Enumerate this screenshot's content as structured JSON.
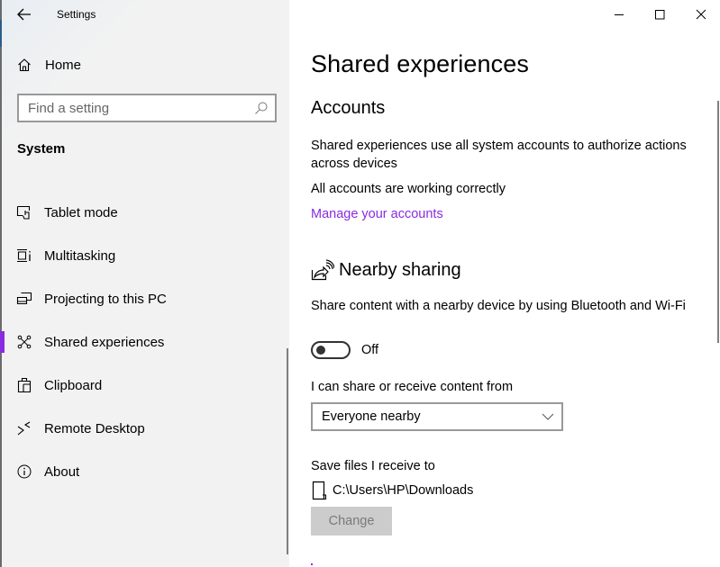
{
  "window": {
    "app_title": "Settings",
    "controls": {
      "minimize": "minimize-icon",
      "maximize": "maximize-icon",
      "close": "close-icon"
    }
  },
  "sidebar": {
    "home_label": "Home",
    "search": {
      "placeholder": "Find a setting",
      "value": ""
    },
    "section_label": "System",
    "items": [
      {
        "label": "Tablet mode",
        "icon": "tablet-mode-icon",
        "active": false
      },
      {
        "label": "Multitasking",
        "icon": "multitasking-icon",
        "active": false
      },
      {
        "label": "Projecting to this PC",
        "icon": "projecting-icon",
        "active": false
      },
      {
        "label": "Shared experiences",
        "icon": "shared-experiences-icon",
        "active": true
      },
      {
        "label": "Clipboard",
        "icon": "clipboard-icon",
        "active": false
      },
      {
        "label": "Remote Desktop",
        "icon": "remote-desktop-icon",
        "active": false
      },
      {
        "label": "About",
        "icon": "info-icon",
        "active": false
      }
    ]
  },
  "main": {
    "page_title": "Shared experiences",
    "accounts": {
      "heading": "Accounts",
      "description": "Shared experiences use all system accounts to authorize actions across devices",
      "status": "All accounts are working correctly",
      "link": "Manage your accounts"
    },
    "nearby_sharing": {
      "heading": "Nearby sharing",
      "description": "Share content with a nearby device by using Bluetooth and Wi-Fi",
      "toggle_state": "Off",
      "share_from_label": "I can share or receive content from",
      "share_from_value": "Everyone nearby",
      "save_label": "Save files I receive to",
      "save_path": "C:\\Users\\HP\\Downloads",
      "change_button": "Change"
    }
  },
  "colors": {
    "accent": "#8a2be2",
    "disabled_button_bg": "#cccccc",
    "sidebar_bg": "#f2f2f2"
  }
}
